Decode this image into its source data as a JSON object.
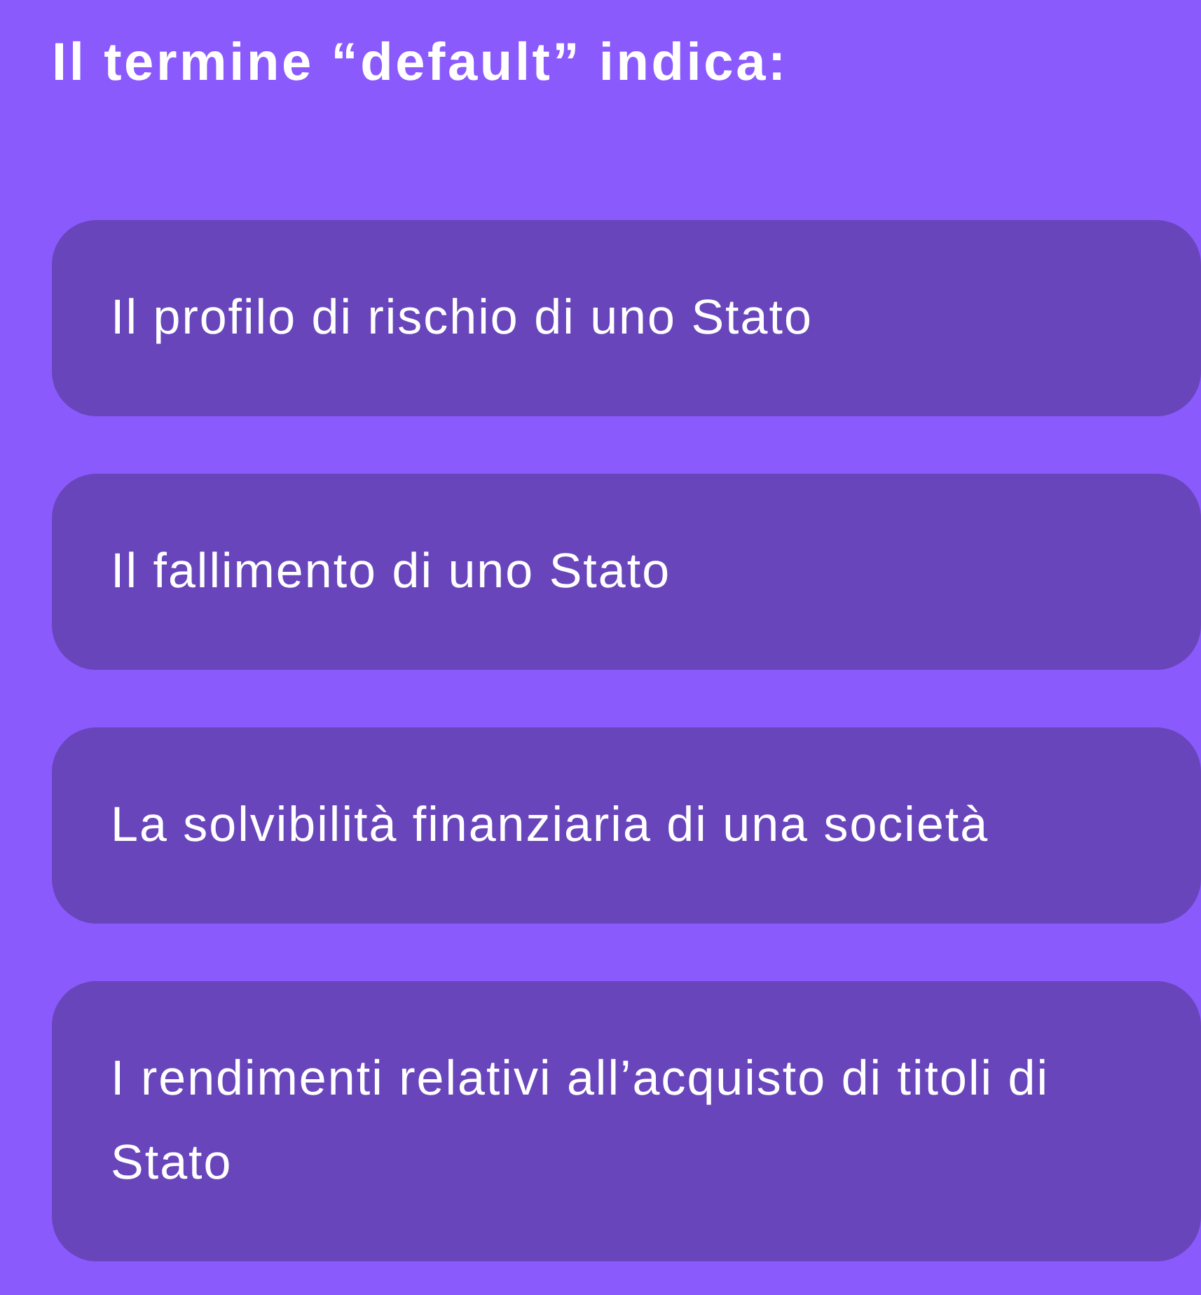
{
  "question": {
    "text": "Il termine “default” indica:"
  },
  "options": [
    {
      "label": "Il profilo di rischio di uno Stato",
      "selected": false
    },
    {
      "label": "Il fallimento di uno Stato",
      "selected": false
    },
    {
      "label": "La solvibilità finanziaria di una società",
      "selected": false
    },
    {
      "label": "I rendimenti relativi all’acquisto di titoli di Stato",
      "selected": false
    }
  ]
}
